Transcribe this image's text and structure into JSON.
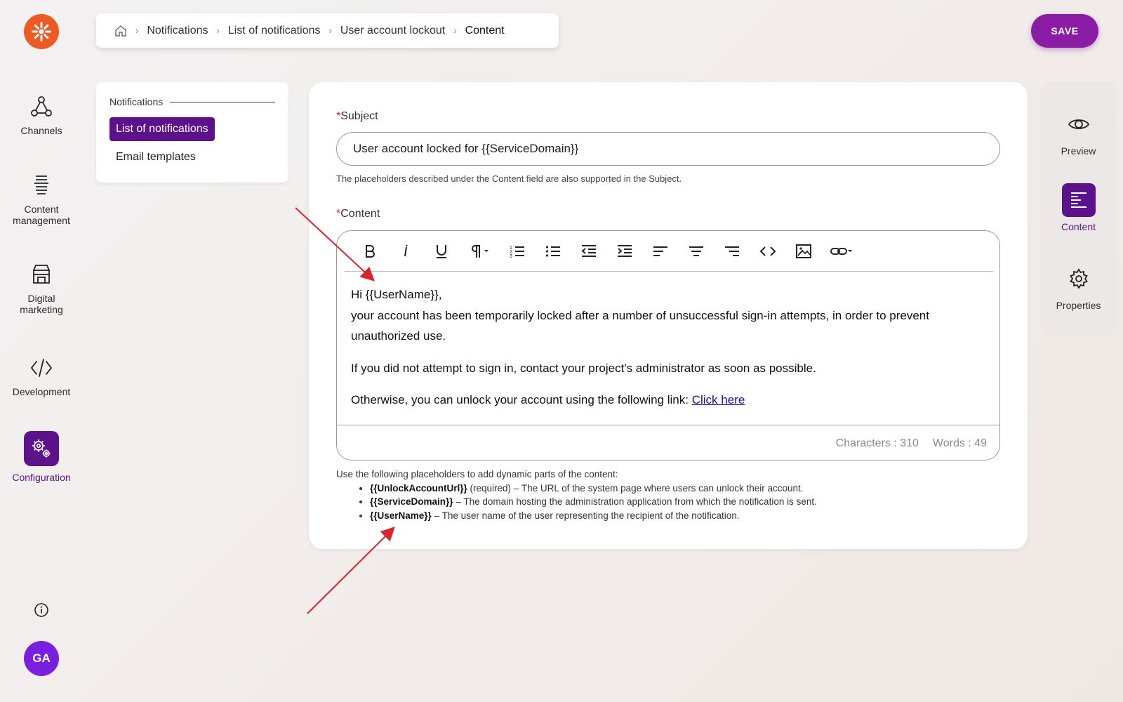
{
  "colors": {
    "accent": "#5b128a",
    "save": "#8a1ca6",
    "logo": "#ee5a24",
    "avatar": "#7a1fe0",
    "arrows": "#d9232e",
    "required": "#d9232e"
  },
  "rail": {
    "items": [
      {
        "label": "Channels",
        "icon": "channels-icon"
      },
      {
        "label": "Content management",
        "icon": "content-management-icon"
      },
      {
        "label": "Digital marketing",
        "icon": "digital-marketing-icon"
      },
      {
        "label": "Development",
        "icon": "code-icon"
      },
      {
        "label": "Configuration",
        "icon": "configuration-icon",
        "active": true
      }
    ],
    "avatar": "GA"
  },
  "breadcrumb": [
    "Notifications",
    "List of notifications",
    "User account lockout",
    "Content"
  ],
  "save_label": "SAVE",
  "subnav": {
    "title": "Notifications",
    "items": [
      "List of notifications",
      "Email templates"
    ]
  },
  "form": {
    "subject_label": "Subject",
    "subject_value": "User account locked for {{ServiceDomain}}",
    "subject_hint": "The placeholders described under the Content field are also supported in the Subject.",
    "content_label": "Content",
    "editor": {
      "line1": "Hi {{UserName}},",
      "line2": "your account has been temporarily locked after a number of unsuccessful sign-in attempts, in order to prevent unauthorized use.",
      "line3": "If you did not attempt to sign in, contact your project's administrator as soon as possible.",
      "line4": "Otherwise, you can unlock your account using the following link: ",
      "link": "Click here"
    },
    "characters": "Characters : 310",
    "words": "Words : 49",
    "placeholders_intro": "Use the following placeholders to add dynamic parts of the content:",
    "placeholders": [
      {
        "name": "{{UnlockAccountUrl}}",
        "desc": " (required) – The URL of the system page where users can unlock their account."
      },
      {
        "name": "{{ServiceDomain}}",
        "desc": " – The domain hosting the administration application from which the notification is sent."
      },
      {
        "name": "{{UserName}}",
        "desc": " – The user name of the user representing the recipient of the notification."
      }
    ]
  },
  "rpanel": [
    "Preview",
    "Content",
    "Properties"
  ]
}
